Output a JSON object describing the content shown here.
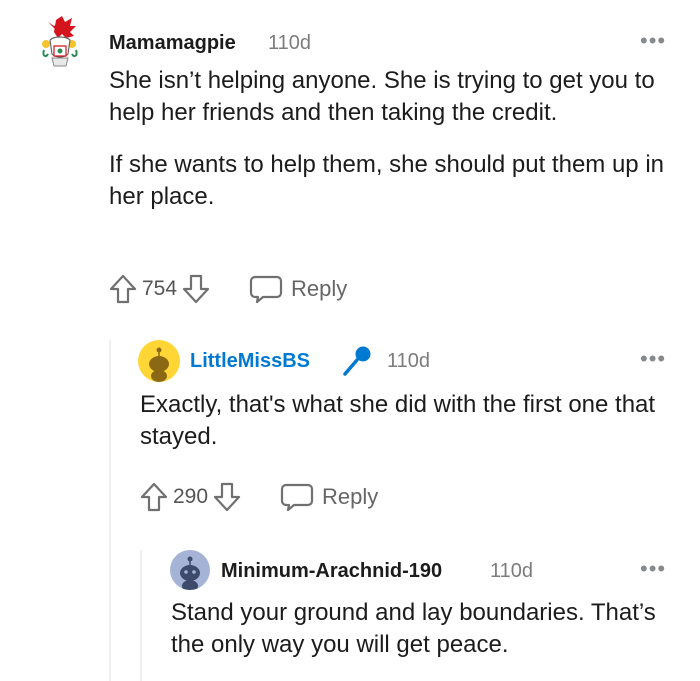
{
  "comments": [
    {
      "username": "Mamamagpie",
      "age": "110d",
      "paragraphs": [
        "She isn’t helping anyone. She is trying to get you to help her friends and then taking the credit.",
        "If she wants to help them, she should put them up in her place."
      ],
      "score": "754",
      "reply_label": "Reply"
    },
    {
      "username": "LittleMissBS",
      "badge_icon": "microphone-icon",
      "age": "110d",
      "text": "Exactly, that's what she did with the first one that stayed.",
      "score": "290",
      "reply_label": "Reply"
    },
    {
      "username": "Minimum-Arachnid-190",
      "age": "110d",
      "text": "Stand your ground and lay boundaries. That’s the only way you will get peace."
    }
  ],
  "more_label": "•••",
  "colors": {
    "op_username": "#0079d3",
    "mic_badge": "#0079d3",
    "thread_line": "#edeff1",
    "dragon_red": "#d4151d"
  }
}
